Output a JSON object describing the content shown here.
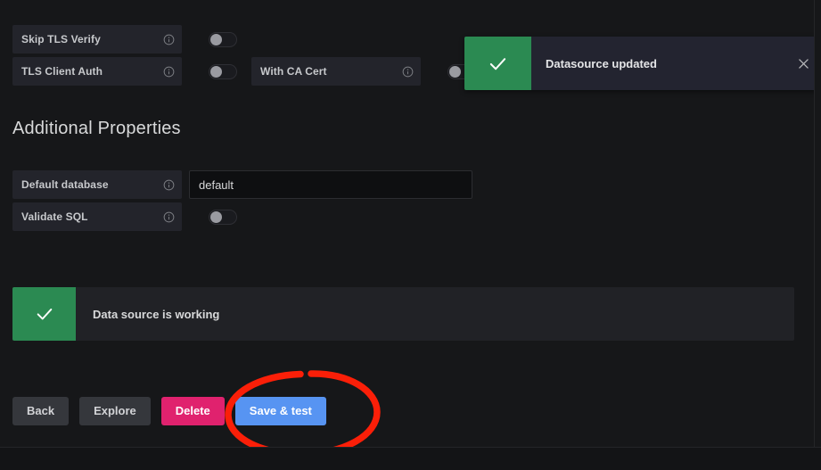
{
  "tls_section": {
    "rows": [
      {
        "label": "Skip TLS Verify",
        "info_icon": "info-circle-icon",
        "toggle_state": "off"
      },
      {
        "label": "TLS Client Auth",
        "info_icon": "info-circle-icon",
        "toggle_state": "off"
      },
      {
        "label": "With CA Cert",
        "info_icon": "info-circle-icon",
        "toggle_state": "off"
      }
    ]
  },
  "additional_properties": {
    "heading": "Additional Properties",
    "default_database": {
      "label": "Default database",
      "info_icon": "info-circle-icon",
      "value": "default",
      "placeholder": "default"
    },
    "validate_sql": {
      "label": "Validate SQL",
      "info_icon": "info-circle-icon",
      "toggle_state": "off"
    }
  },
  "test_result": {
    "message": "Data source is working",
    "icon": "check-icon",
    "status": "success",
    "accent_color": "#2b8a52"
  },
  "actions": {
    "back_label": "Back",
    "explore_label": "Explore",
    "delete_label": "Delete",
    "save_test_label": "Save & test",
    "primary_color": "#5794f2",
    "danger_color": "#e0226e"
  },
  "toast": {
    "message": "Datasource updated",
    "icon": "check-icon",
    "close_icon": "close-icon",
    "accent_color": "#2b8a52"
  },
  "annotation": {
    "shape": "ellipse-highlight",
    "color": "#fb1f08",
    "targets": "save-test-button"
  }
}
